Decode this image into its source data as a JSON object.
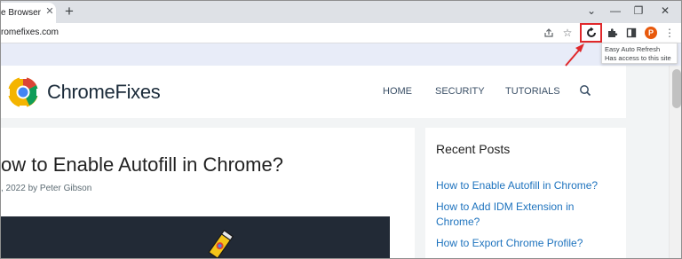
{
  "browser": {
    "tab": {
      "title": "e Browser"
    },
    "window_controls": [
      "⌄",
      "—",
      "❐",
      "✕"
    ],
    "url": "romefixes.com",
    "profile_initial": "P",
    "extension_tooltip": {
      "name": "Easy Auto Refresh",
      "access": "Has access to this site"
    }
  },
  "site": {
    "logo_text": "ChromeFixes",
    "nav": [
      "HOME",
      "SECURITY",
      "TUTORIALS"
    ],
    "article": {
      "title": "ow to Enable Autofill in Chrome?",
      "byline": ", 2022 by Peter Gibson"
    },
    "sidebar": {
      "title": "Recent Posts",
      "posts": [
        "How to Enable Autofill in Chrome?",
        "How to Add IDM Extension in Chrome?",
        "How to Export Chrome Profile?"
      ]
    }
  },
  "colors": {
    "highlight": "#e0282b",
    "link": "#1e73be",
    "avatar": "#e8590c"
  },
  "icons": [
    "close-icon",
    "plus-icon",
    "share-icon",
    "star-icon",
    "refresh-extension-icon",
    "puzzle-icon",
    "side-panel-icon",
    "kebab-menu-icon",
    "search-icon",
    "gear-logo-icon"
  ]
}
